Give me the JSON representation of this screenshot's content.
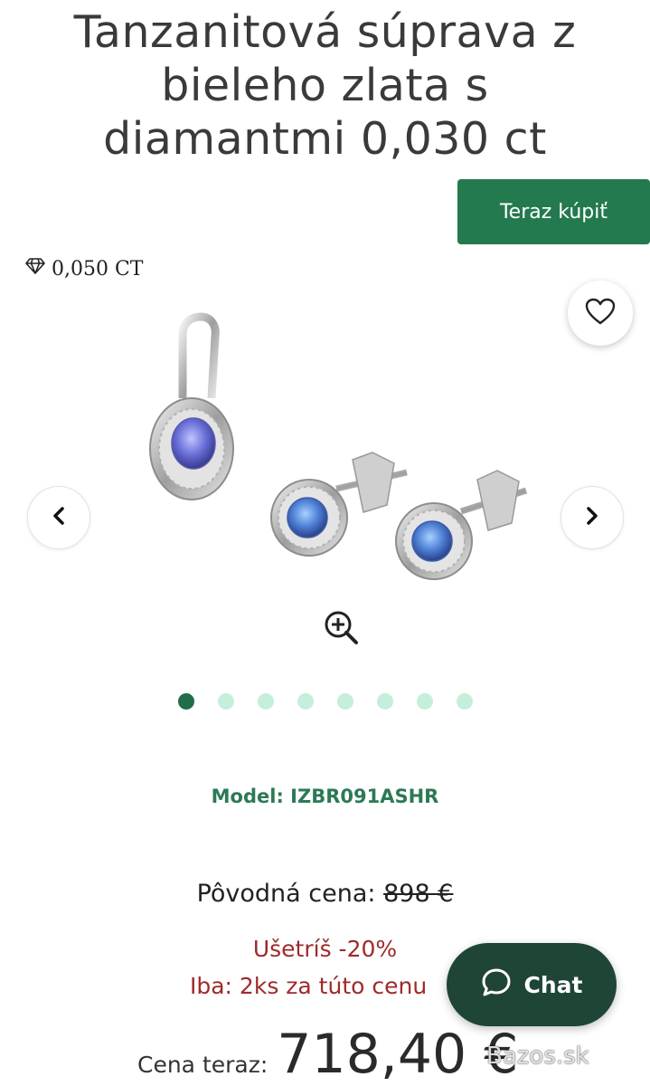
{
  "product": {
    "title_line1": "Tanzanitová súprava z",
    "title_line2": "bieleho zlata s",
    "title_line3": "diamantmi 0,030 ct",
    "carat_badge": "0,050 CT",
    "model_text": "Model: IZBR091ASHR"
  },
  "actions": {
    "buy_label": "Teraz kúpiť",
    "chat_label": "Chat"
  },
  "gallery": {
    "image_alt": "Tanzanitová súprava – prívesok a náušnice",
    "dot_count": 8,
    "active_index": 0,
    "icons": [
      "heart-icon",
      "chevron-left-icon",
      "chevron-right-icon",
      "zoom-in-icon",
      "diamond-icon",
      "chat-bubble-icon"
    ]
  },
  "pricing": {
    "original_label": "Pôvodná cena:",
    "original_value": "898 €",
    "discount_text": "Ušetríš -20%",
    "stock_text": "Iba: 2ks za túto cenu",
    "now_label": "Cena teraz:",
    "now_value": "718,40 €"
  },
  "watermark": {
    "text": "Bazos.sk"
  },
  "colors": {
    "brand_green": "#237a4e",
    "dot_active": "#1f6e47",
    "dot_inactive": "#c5eedb",
    "alert_red": "#9e2a2a",
    "chat_bg": "#1e4536"
  }
}
